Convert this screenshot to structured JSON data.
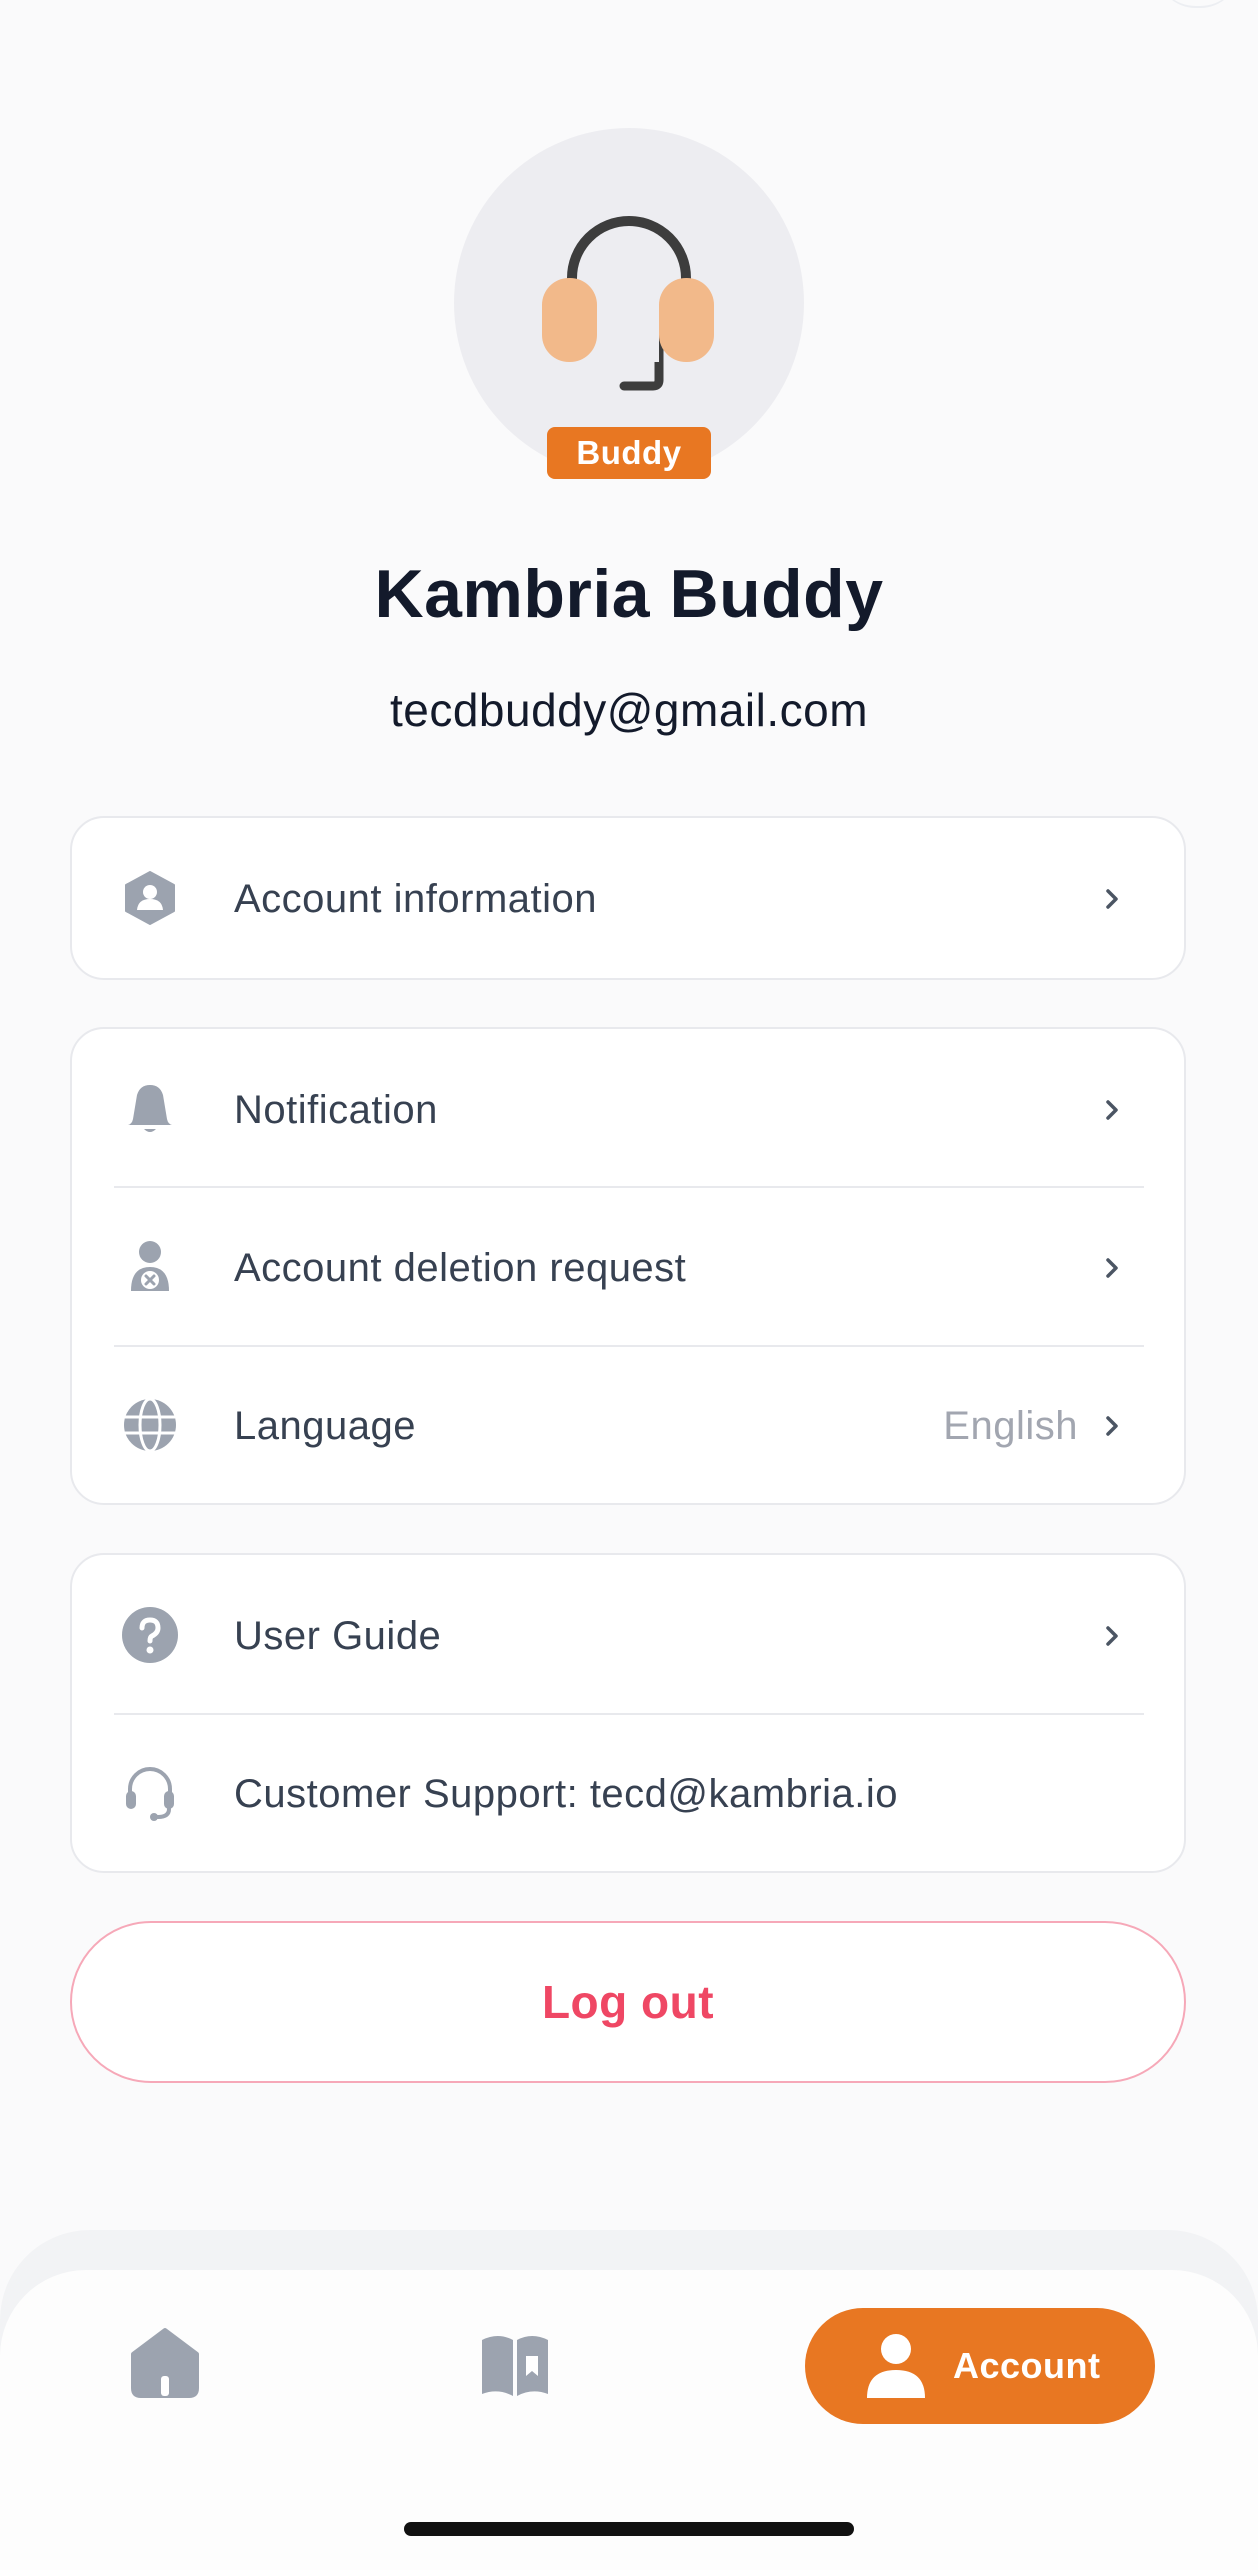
{
  "profile": {
    "role_badge": "Buddy",
    "name": "Kambria Buddy",
    "email": "tecdbuddy@gmail.com",
    "avatar_icon": "headset-icon"
  },
  "menu": {
    "account_information": {
      "label": "Account information",
      "icon": "user-shield-icon"
    },
    "notification": {
      "label": "Notification",
      "icon": "bell-icon"
    },
    "account_deletion": {
      "label": "Account deletion request",
      "icon": "user-remove-icon"
    },
    "language": {
      "label": "Language",
      "value": "English",
      "icon": "globe-icon"
    },
    "user_guide": {
      "label": "User Guide",
      "icon": "question-circle-icon"
    },
    "customer_support": {
      "label": "Customer Support: tecd@kambria.io",
      "icon": "headset-icon"
    }
  },
  "logout": {
    "label": "Log out"
  },
  "bottom_nav": {
    "home_icon": "home-icon",
    "guide_icon": "book-icon",
    "account_label": "Account",
    "account_icon": "user-icon",
    "active": "account"
  },
  "colors": {
    "accent": "#e87722",
    "danger": "#ef4764",
    "icon_gray": "#9ca3af",
    "text": "#374151",
    "heading": "#131a2b"
  }
}
